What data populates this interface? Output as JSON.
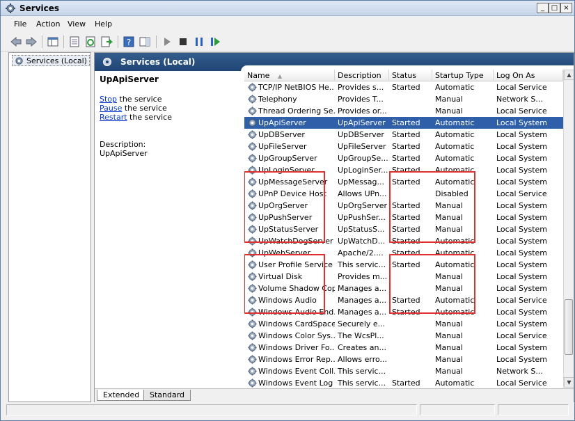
{
  "window": {
    "title": "Services",
    "minimize_glyph": "_",
    "maximize_glyph": "□",
    "close_glyph": "×"
  },
  "menu": [
    "File",
    "Action",
    "View",
    "Help"
  ],
  "toolbar_icons": [
    "back-icon",
    "forward-icon",
    "show-hide-tree-icon",
    "properties-icon",
    "refresh-icon",
    "export-list-icon",
    "help-icon",
    "show-hide-action-pane-icon",
    "start-service-icon",
    "stop-service-icon",
    "pause-service-icon",
    "restart-service-icon"
  ],
  "tree": {
    "root_label": "Services (Local)"
  },
  "header": {
    "title": "Services (Local)"
  },
  "detail": {
    "service_name": "UpApiServer",
    "stop_link": "Stop",
    "stop_rest": " the service",
    "pause_link": "Pause",
    "pause_rest": " the service",
    "restart_link": "Restart",
    "restart_rest": " the service",
    "description_label": "Description:",
    "description_value": "UpApiServer"
  },
  "columns": {
    "name": "Name",
    "description": "Description",
    "status": "Status",
    "startup": "Startup Type",
    "logon": "Log On As"
  },
  "services": [
    {
      "name": "TCP/IP NetBIOS He...",
      "description": "Provides s...",
      "status": "Started",
      "startup": "Automatic",
      "logon": "Local Service"
    },
    {
      "name": "Telephony",
      "description": "Provides T...",
      "status": "",
      "startup": "Manual",
      "logon": "Network S..."
    },
    {
      "name": "Thread Ordering Se...",
      "description": "Provides or...",
      "status": "",
      "startup": "Manual",
      "logon": "Local Service"
    },
    {
      "name": "UpApiServer",
      "description": "UpApiServer",
      "status": "Started",
      "startup": "Automatic",
      "logon": "Local System"
    },
    {
      "name": "UpDBServer",
      "description": "UpDBServer",
      "status": "Started",
      "startup": "Automatic",
      "logon": "Local System"
    },
    {
      "name": "UpFileServer",
      "description": "UpFileServer",
      "status": "Started",
      "startup": "Automatic",
      "logon": "Local System"
    },
    {
      "name": "UpGroupServer",
      "description": "UpGroupSe...",
      "status": "Started",
      "startup": "Automatic",
      "logon": "Local System"
    },
    {
      "name": "UpLoginServer",
      "description": "UpLoginSer...",
      "status": "Started",
      "startup": "Automatic",
      "logon": "Local System"
    },
    {
      "name": "UpMessageServer",
      "description": "UpMessag...",
      "status": "Started",
      "startup": "Automatic",
      "logon": "Local System"
    },
    {
      "name": "UPnP Device Host",
      "description": "Allows UPn...",
      "status": "",
      "startup": "Disabled",
      "logon": "Local Service"
    },
    {
      "name": "UpOrgServer",
      "description": "UpOrgServer",
      "status": "Started",
      "startup": "Manual",
      "logon": "Local System"
    },
    {
      "name": "UpPushServer",
      "description": "UpPushSer...",
      "status": "Started",
      "startup": "Manual",
      "logon": "Local System"
    },
    {
      "name": "UpStatusServer",
      "description": "UpStatusS...",
      "status": "Started",
      "startup": "Manual",
      "logon": "Local System"
    },
    {
      "name": "UpWatchDogServer",
      "description": "UpWatchD...",
      "status": "Started",
      "startup": "Automatic",
      "logon": "Local System"
    },
    {
      "name": "UpWebServer",
      "description": "Apache/2....",
      "status": "Started",
      "startup": "Automatic",
      "logon": "Local System"
    },
    {
      "name": "User Profile Service",
      "description": "This servic...",
      "status": "Started",
      "startup": "Automatic",
      "logon": "Local System"
    },
    {
      "name": "Virtual Disk",
      "description": "Provides m...",
      "status": "",
      "startup": "Manual",
      "logon": "Local System"
    },
    {
      "name": "Volume Shadow Copy",
      "description": "Manages a...",
      "status": "",
      "startup": "Manual",
      "logon": "Local System"
    },
    {
      "name": "Windows Audio",
      "description": "Manages a...",
      "status": "Started",
      "startup": "Automatic",
      "logon": "Local Service"
    },
    {
      "name": "Windows Audio End...",
      "description": "Manages a...",
      "status": "Started",
      "startup": "Automatic",
      "logon": "Local System"
    },
    {
      "name": "Windows CardSpace",
      "description": "Securely e...",
      "status": "",
      "startup": "Manual",
      "logon": "Local System"
    },
    {
      "name": "Windows Color Sys...",
      "description": "The WcsPl...",
      "status": "",
      "startup": "Manual",
      "logon": "Local Service"
    },
    {
      "name": "Windows Driver Fo...",
      "description": "Creates an...",
      "status": "",
      "startup": "Manual",
      "logon": "Local System"
    },
    {
      "name": "Windows Error Rep...",
      "description": "Allows erro...",
      "status": "",
      "startup": "Manual",
      "logon": "Local System"
    },
    {
      "name": "Windows Event Coll...",
      "description": "This servic...",
      "status": "",
      "startup": "Manual",
      "logon": "Network S..."
    },
    {
      "name": "Windows Event Log",
      "description": "This servic...",
      "status": "Started",
      "startup": "Automatic",
      "logon": "Local Service"
    }
  ],
  "selected_service": "UpApiServer",
  "tabs": {
    "extended": "Extended",
    "standard": "Standard"
  },
  "colors": {
    "selection": "#2e5fa8",
    "highlight_box": "#e03030",
    "header_blue": "#1f4574",
    "link": "#0033cc"
  }
}
